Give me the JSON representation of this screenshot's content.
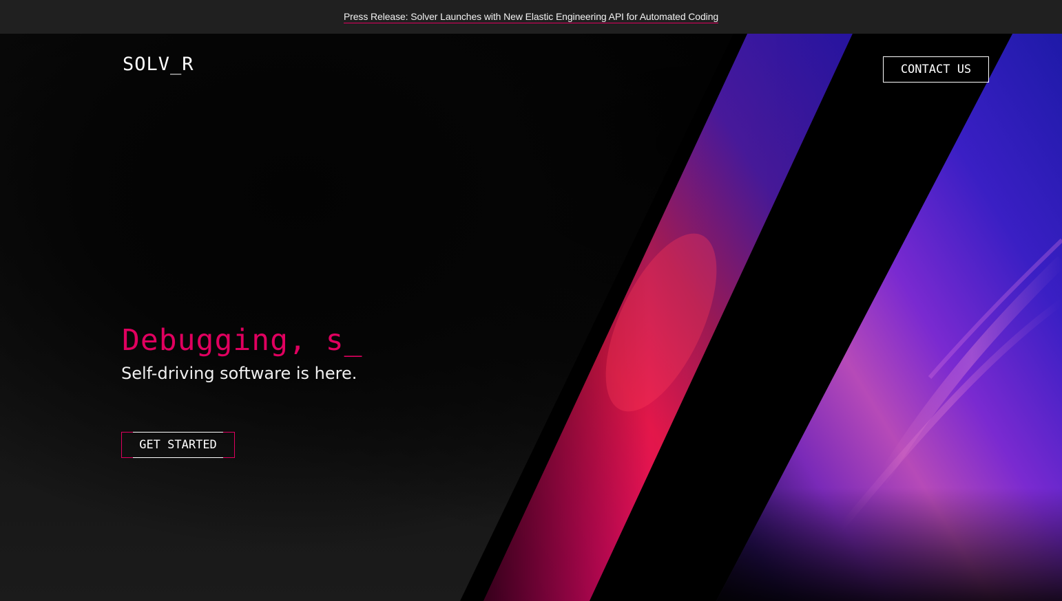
{
  "announcement": {
    "text": "Press Release: Solver Launches with New Elastic Engineering API for Automated Coding"
  },
  "header": {
    "logo": "SOLV_R",
    "contact_label": "CONTACT US"
  },
  "hero": {
    "headline": "Debugging, s_",
    "subheadline": "Self-driving software is here.",
    "cta_label": "GET STARTED"
  },
  "colors": {
    "accent": "#e0005f",
    "background": "#1a1a1a",
    "topbar": "#202020",
    "text": "#ffffff"
  }
}
